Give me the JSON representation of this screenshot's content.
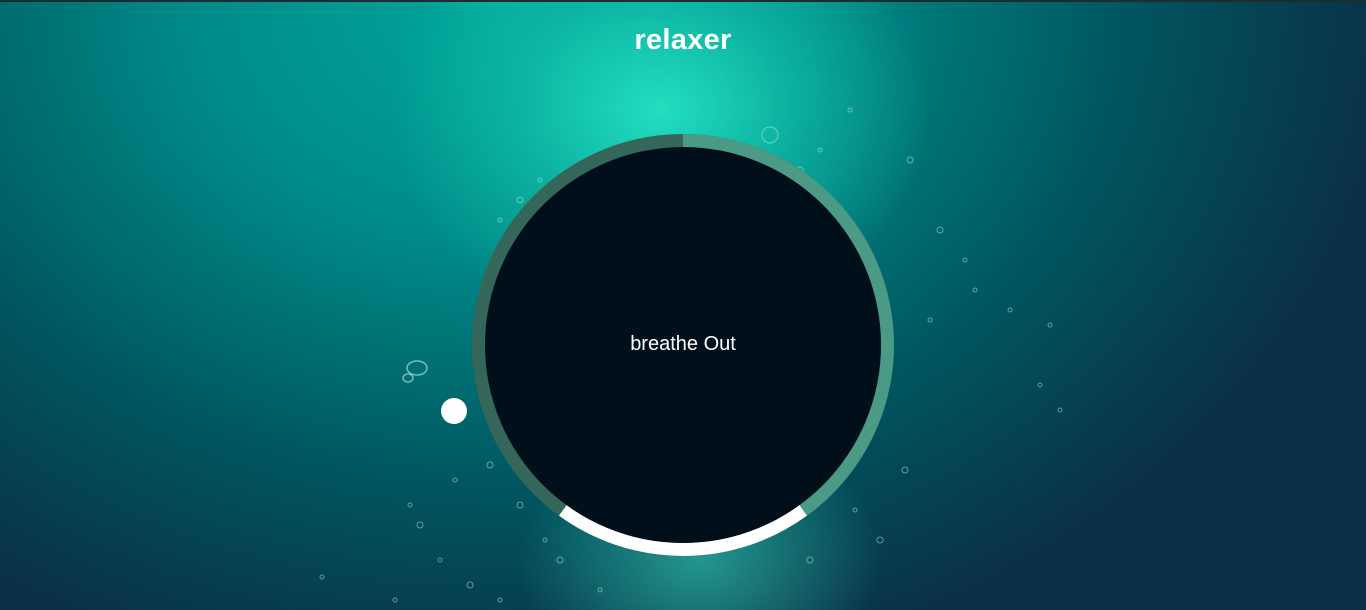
{
  "app": {
    "title": "relaxer"
  },
  "breathing": {
    "instruction": "breathe Out",
    "phase_colors": {
      "breathe_in": "#4a9a86",
      "hold": "#ffffff",
      "breathe_out": "#35665a"
    }
  },
  "colors": {
    "circle_fill": "#010f1a",
    "text": "#ffffff",
    "pointer": "#ffffff"
  }
}
